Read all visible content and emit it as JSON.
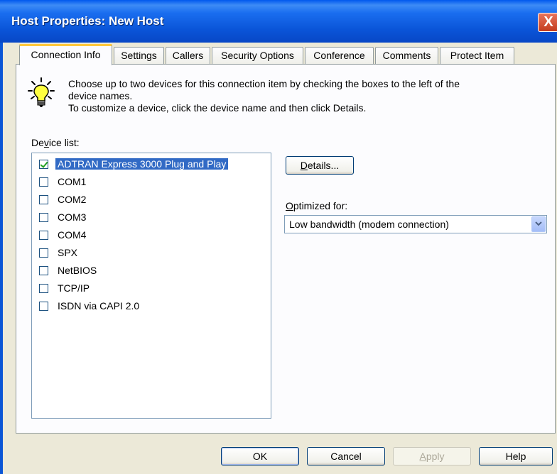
{
  "window": {
    "title": "Host Properties: New Host",
    "close_glyph": "X"
  },
  "tabs": [
    {
      "label": "Connection Info",
      "active": true
    },
    {
      "label": "Settings"
    },
    {
      "label": "Callers"
    },
    {
      "label": "Security Options"
    },
    {
      "label": "Conference"
    },
    {
      "label": "Comments"
    },
    {
      "label": "Protect Item"
    }
  ],
  "instructions": {
    "line1": "Choose up to two devices for this connection item by checking the boxes to the left of the",
    "line2": "device names.",
    "line3": "To customize a device, click the device name and then click Details.",
    "icon": "lightbulb-icon"
  },
  "device_list": {
    "label_pre": "De",
    "label_underline": "v",
    "label_post": "ice list:",
    "items": [
      {
        "label": "ADTRAN Express 3000 Plug and Play",
        "checked": true,
        "selected": true
      },
      {
        "label": "COM1",
        "checked": false
      },
      {
        "label": "COM2",
        "checked": false
      },
      {
        "label": "COM3",
        "checked": false
      },
      {
        "label": "COM4",
        "checked": false
      },
      {
        "label": "SPX",
        "checked": false
      },
      {
        "label": "NetBIOS",
        "checked": false
      },
      {
        "label": "TCP/IP",
        "checked": false
      },
      {
        "label": "ISDN via CAPI 2.0",
        "checked": false
      }
    ]
  },
  "details_button": {
    "underline": "D",
    "rest": "etails..."
  },
  "optimized": {
    "label_underline": "O",
    "label_rest": "ptimized for:",
    "value": "Low bandwidth (modem connection)"
  },
  "footer": {
    "ok": "OK",
    "cancel": "Cancel",
    "apply_underline": "A",
    "apply_rest": "pply",
    "help": "Help"
  },
  "colors": {
    "title_bar": "#0a54d8",
    "selection": "#316ac5",
    "tab_highlight": "#ffc83c"
  }
}
